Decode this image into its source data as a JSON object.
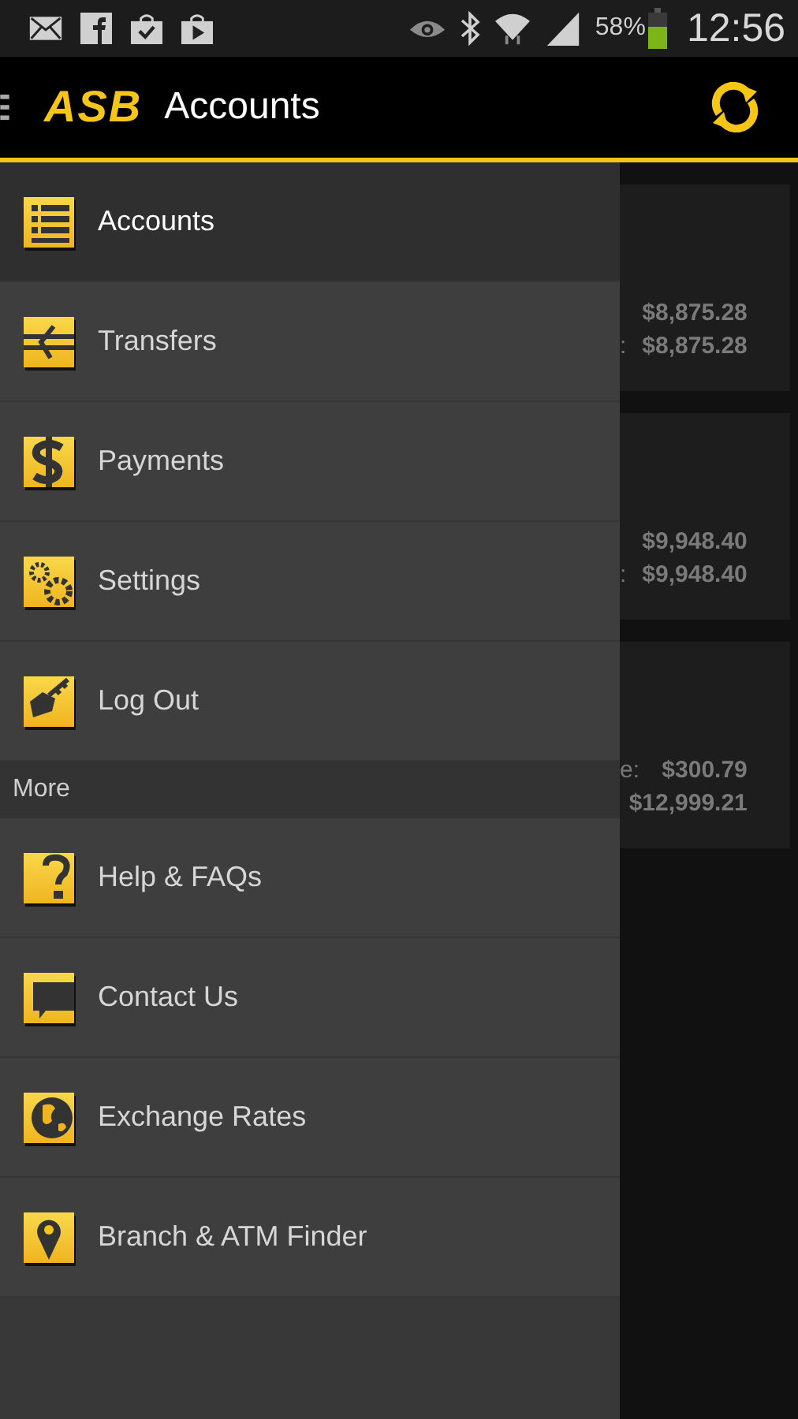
{
  "status_bar": {
    "battery_text": "58%",
    "time": "12:56"
  },
  "app_bar": {
    "logo": "ASB",
    "title": "Accounts"
  },
  "drawer": {
    "items": [
      {
        "label": "Accounts",
        "kind": "list",
        "selected": true
      },
      {
        "label": "Transfers",
        "kind": "transfer",
        "selected": false
      },
      {
        "label": "Payments",
        "kind": "dollar",
        "selected": false
      },
      {
        "label": "Settings",
        "kind": "gears",
        "selected": false
      },
      {
        "label": "Log Out",
        "kind": "key",
        "selected": false
      }
    ],
    "section": "More",
    "more_items": [
      {
        "label": "Help & FAQs",
        "kind": "help",
        "selected": false
      },
      {
        "label": "Contact Us",
        "kind": "chat",
        "selected": false
      },
      {
        "label": "Exchange Rates",
        "kind": "globe",
        "selected": false
      },
      {
        "label": "Branch & ATM Finder",
        "kind": "pin",
        "selected": false
      }
    ]
  },
  "cards": [
    {
      "lines": [
        {
          "value": "$8,875.28"
        },
        {
          "label": ":",
          "value": "$8,875.28"
        }
      ]
    },
    {
      "lines": [
        {
          "value": "$9,948.40"
        },
        {
          "label": ":",
          "value": "$9,948.40"
        }
      ]
    },
    {
      "lines": [
        {
          "label": "e:",
          "value": "$300.79"
        },
        {
          "value": "$12,999.21"
        }
      ]
    }
  ]
}
